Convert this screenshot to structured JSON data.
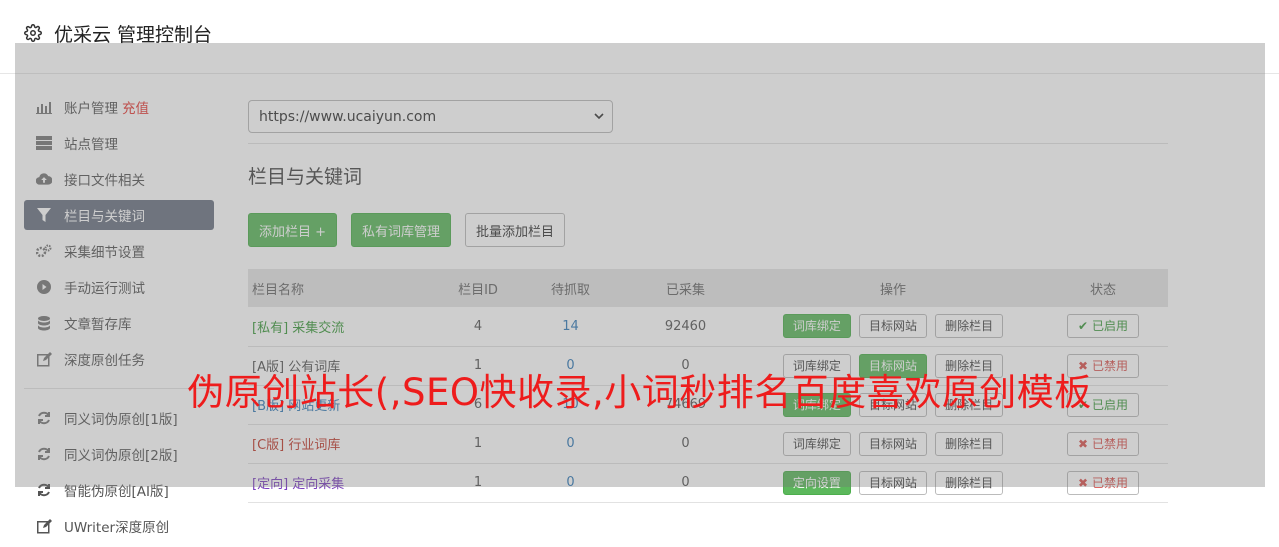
{
  "header": {
    "title": "优采云 管理控制台",
    "icon": "gear-icon"
  },
  "sidebar": {
    "items": [
      {
        "label": "账户管理",
        "extra": "充值",
        "icon": "bar-chart-icon"
      },
      {
        "label": "站点管理",
        "icon": "server-icon"
      },
      {
        "label": "接口文件相关",
        "icon": "cloud-upload-icon"
      },
      {
        "label": "栏目与关键词",
        "icon": "filter-icon",
        "active": true
      },
      {
        "label": "采集细节设置",
        "icon": "cogs-icon"
      },
      {
        "label": "手动运行测试",
        "icon": "play-circle-icon"
      },
      {
        "label": "文章暂存库",
        "icon": "database-icon"
      },
      {
        "label": "深度原创任务",
        "icon": "edit-icon"
      },
      {
        "label": "同义词伪原创[1版]",
        "icon": "refresh-icon"
      },
      {
        "label": "同义词伪原创[2版]",
        "icon": "refresh-icon"
      },
      {
        "label": "智能伪原创[AI版]",
        "icon": "refresh-icon"
      },
      {
        "label": "UWriter深度原创",
        "icon": "edit-icon"
      }
    ]
  },
  "main": {
    "site_select": "https://www.ucaiyun.com",
    "section_title": "栏目与关键词",
    "buttons": {
      "add_column": "添加栏目 +",
      "private_lib": "私有词库管理",
      "batch_add": "批量添加栏目"
    },
    "table": {
      "headers": [
        "栏目名称",
        "栏目ID",
        "待抓取",
        "已采集",
        "操作",
        "状态"
      ],
      "rows": [
        {
          "tag": "[私有]",
          "name": "采集交流",
          "id": "4",
          "pending": "14",
          "collected": "92460",
          "op1": "词库绑定",
          "op2": "目标网站",
          "op3": "删除栏目",
          "status": "已启用"
        },
        {
          "tag": "[A版]",
          "name": "公有词库",
          "id": "1",
          "pending": "0",
          "collected": "0",
          "op1": "词库绑定",
          "op2": "目标网站",
          "op3": "删除栏目",
          "status": "已禁用"
        },
        {
          "tag": "[B版]",
          "name": "网站更新",
          "id": "6",
          "pending": "10",
          "collected": "74669",
          "op1": "词库绑定",
          "op2": "目标网站",
          "op3": "删除栏目",
          "status": "已启用"
        },
        {
          "tag": "[C版]",
          "name": "行业词库",
          "id": "1",
          "pending": "0",
          "collected": "0",
          "op1": "词库绑定",
          "op2": "目标网站",
          "op3": "删除栏目",
          "status": "已禁用"
        },
        {
          "tag": "[定向]",
          "name": "定向采集",
          "id": "1",
          "pending": "0",
          "collected": "0",
          "op1": "定向设置",
          "op2": "目标网站",
          "op3": "删除栏目",
          "status": "已禁用"
        }
      ]
    }
  },
  "banner": {
    "text": "伪原创站长(,SEO快收录,小词秒排名百度喜欢原创模板"
  },
  "colors": {
    "active_nav": "#6b7383",
    "green": "#5cb85c",
    "red": "#e53935",
    "banner_red": "#ee1c1c",
    "link_blue": "#337ab7"
  }
}
